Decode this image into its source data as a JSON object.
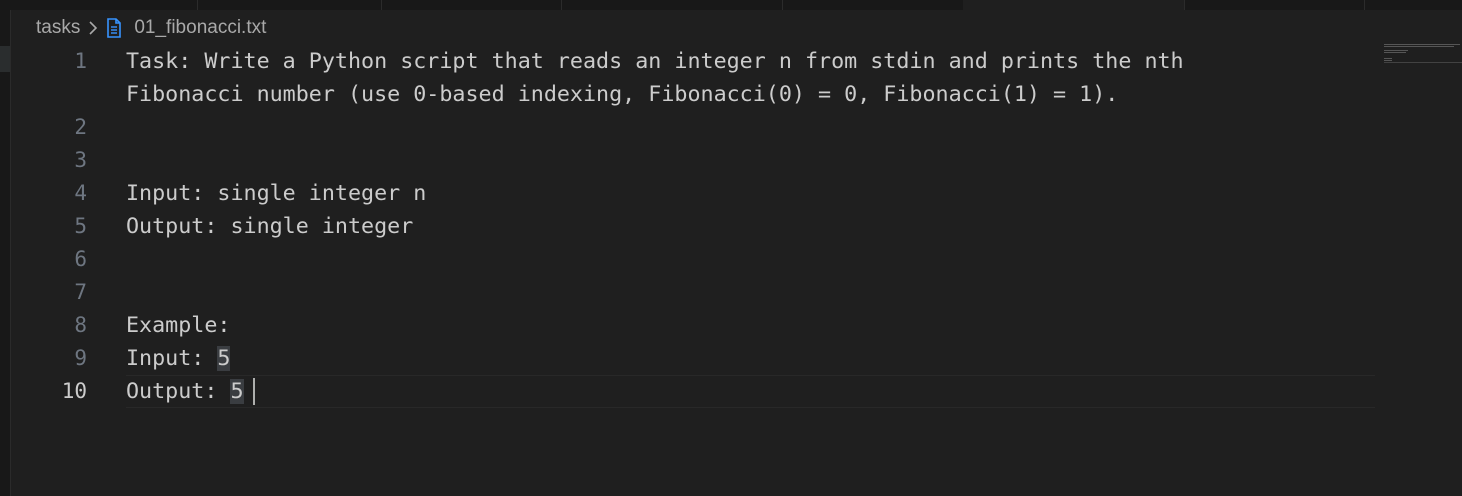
{
  "breadcrumb": {
    "folder": "tasks",
    "file": "01_fibonacci.txt",
    "file_icon": "text-file-icon",
    "separator_icon": "chevron-right-icon"
  },
  "editor": {
    "active_line": 10,
    "lines": [
      {
        "n": "1",
        "text": "Task: Write a Python script that reads an integer n from stdin and prints the nth"
      },
      {
        "n": "",
        "text": "Fibonacci number (use 0-based indexing, Fibonacci(0) = 0, Fibonacci(1) = 1)."
      },
      {
        "n": "2",
        "text": ""
      },
      {
        "n": "3",
        "text": ""
      },
      {
        "n": "4",
        "text": "Input: single integer n"
      },
      {
        "n": "5",
        "text": "Output: single integer"
      },
      {
        "n": "6",
        "text": ""
      },
      {
        "n": "7",
        "text": ""
      },
      {
        "n": "8",
        "text": "Example:"
      },
      {
        "n": "9",
        "text": "Input: ",
        "highlight": "5"
      },
      {
        "n": "10",
        "text": "Output: ",
        "highlight": "5"
      }
    ]
  },
  "colors": {
    "background": "#1f1f1f",
    "text": "#cccccc",
    "line_number": "#6e7681",
    "active_line_number": "#cccccc",
    "file_icon": "#3794ff"
  }
}
